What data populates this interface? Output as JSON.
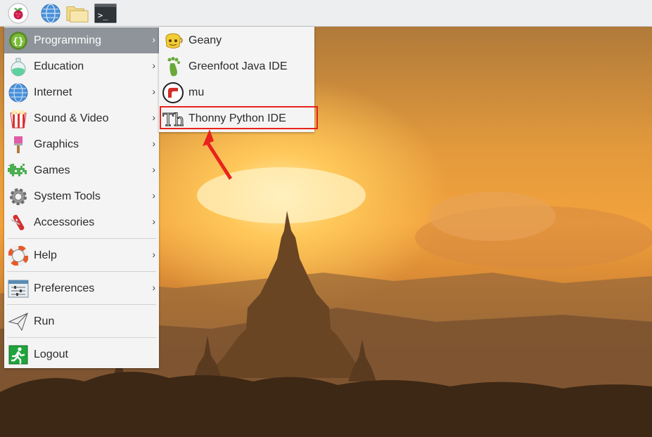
{
  "panel": {
    "buttons": [
      {
        "name": "raspberry-menu-icon"
      },
      {
        "name": "web-browser-icon"
      },
      {
        "name": "file-manager-icon"
      },
      {
        "name": "terminal-icon",
        "glyph": ">_"
      }
    ]
  },
  "main_menu": {
    "items": [
      {
        "label": "Programming",
        "icon": "programming-icon"
      },
      {
        "label": "Education",
        "icon": "education-icon"
      },
      {
        "label": "Internet",
        "icon": "internet-icon"
      },
      {
        "label": "Sound & Video",
        "icon": "sound-video-icon"
      },
      {
        "label": "Graphics",
        "icon": "graphics-icon"
      },
      {
        "label": "Games",
        "icon": "games-icon"
      },
      {
        "label": "System Tools",
        "icon": "system-tools-icon"
      },
      {
        "label": "Accessories",
        "icon": "accessories-icon"
      },
      {
        "label": "Help",
        "icon": "help-icon"
      },
      {
        "label": "Preferences",
        "icon": "preferences-icon"
      },
      {
        "label": "Run",
        "icon": "run-icon"
      },
      {
        "label": "Logout",
        "icon": "logout-icon"
      }
    ],
    "submenu_arrow": "›"
  },
  "programming_submenu": {
    "items": [
      {
        "label": "Geany",
        "icon": "geany-icon"
      },
      {
        "label": "Greenfoot Java IDE",
        "icon": "greenfoot-icon"
      },
      {
        "label": "mu",
        "icon": "mu-icon"
      },
      {
        "label": "Thonny Python IDE",
        "icon": "thonny-icon",
        "glyph": "Th"
      }
    ]
  },
  "annotation": {
    "color": "#e8231c"
  },
  "colors": {
    "active_item": "#8e949a",
    "menu_bg": "#f4f4f4",
    "panel_bg": "#edeef0"
  }
}
